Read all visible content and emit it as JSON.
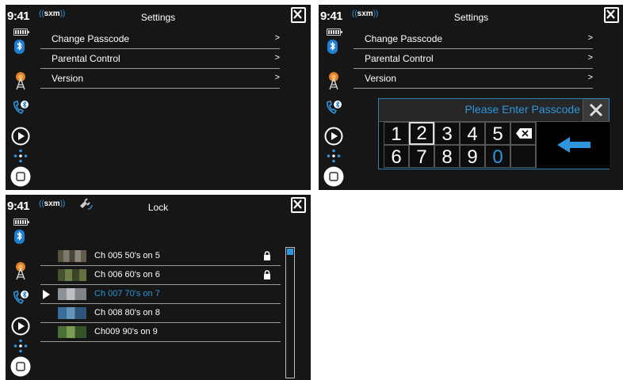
{
  "status": {
    "time": "9:41",
    "brand": "sxm",
    "icons": [
      "battery-icon",
      "bluetooth-icon",
      "radio-tower-icon",
      "phone-icon",
      "play-icon",
      "navigation-dots-icon",
      "home-button-icon"
    ]
  },
  "colors": {
    "accent": "#2f95dc",
    "background": "#161616",
    "divider": "#9a9a9a"
  },
  "settings_screen": {
    "title": "Settings",
    "items": [
      {
        "label": "Change Passcode",
        "chevron": ">"
      },
      {
        "label": "Parental Control",
        "chevron": ">"
      },
      {
        "label": "Version",
        "chevron": ">"
      }
    ]
  },
  "passcode_screen": {
    "title": "Settings",
    "items": [
      {
        "label": "Change Passcode",
        "chevron": ">"
      },
      {
        "label": "Parental Control",
        "chevron": ">"
      },
      {
        "label": "Version",
        "chevron": ">"
      }
    ],
    "keypad": {
      "prompt": "Please Enter Passcode",
      "keys_row1": [
        "1",
        "2",
        "3",
        "4",
        "5"
      ],
      "keys_row2": [
        "6",
        "7",
        "8",
        "9",
        "0"
      ],
      "highlighted_key": "2",
      "blue_key": "0"
    }
  },
  "lock_screen": {
    "title": "Lock",
    "channels": [
      {
        "label": "Ch 005 50's on 5",
        "locked": true,
        "selected": false
      },
      {
        "label": "Ch 006 60's on 6",
        "locked": true,
        "selected": false
      },
      {
        "label": "Ch 007 70's on 7",
        "locked": false,
        "selected": true
      },
      {
        "label": "Ch 008 80's on 8",
        "locked": false,
        "selected": false
      },
      {
        "label": "Ch009 90's on 9",
        "locked": false,
        "selected": false
      }
    ]
  }
}
